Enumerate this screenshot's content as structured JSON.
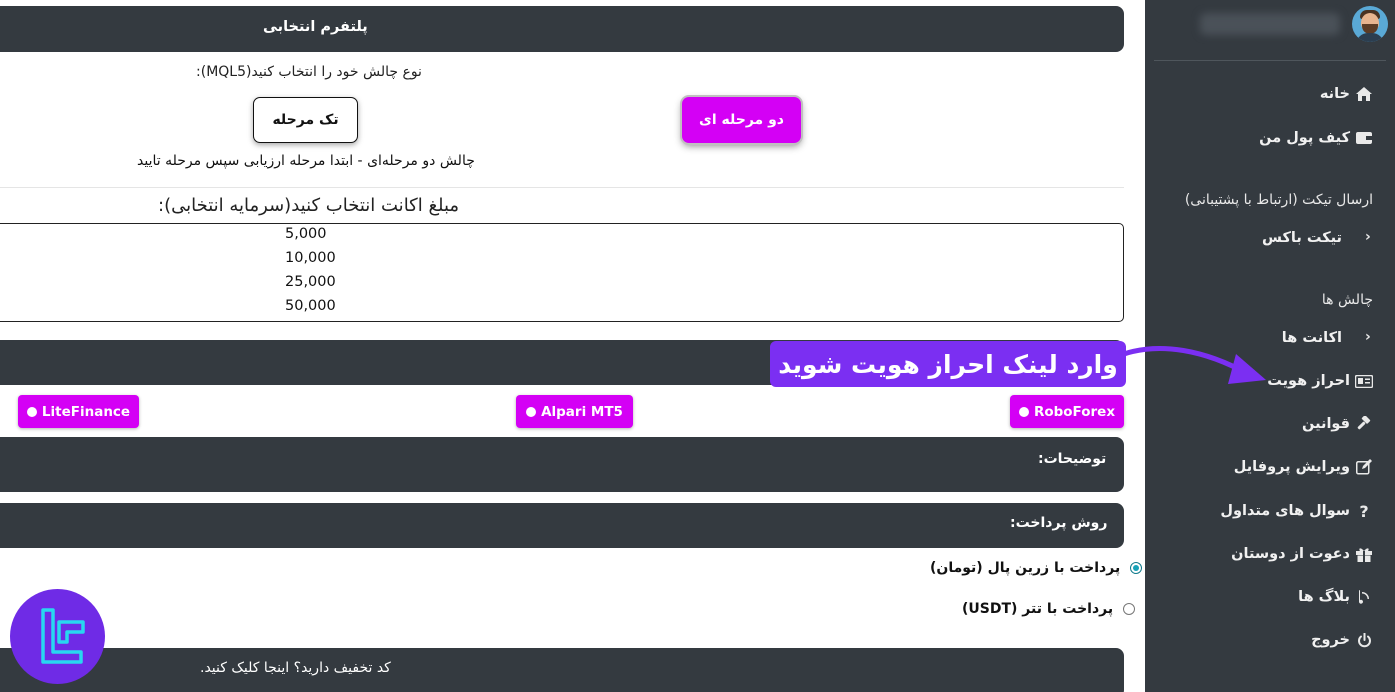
{
  "sidebar": {
    "items": [
      {
        "label": "خانه",
        "icon": "home-icon"
      },
      {
        "label": "کیف پول من",
        "icon": "wallet-icon"
      },
      {
        "label": "ارسال تیکت (ارتباط با پشتیبانی)"
      },
      {
        "label": "تیکت باکس"
      },
      {
        "label": "چالش ها"
      },
      {
        "label": "اکانت ها"
      },
      {
        "label": "احراز هویت",
        "icon": "id-card-icon"
      },
      {
        "label": "قوانین",
        "icon": "gavel-icon"
      },
      {
        "label": "ویرایش پروفایل",
        "icon": "edit-icon"
      },
      {
        "label": "سوال های متداول",
        "icon": "question-icon"
      },
      {
        "label": "دعوت از دوستان",
        "icon": "gift-icon"
      },
      {
        "label": "بلاگ ها",
        "icon": "blog-icon"
      },
      {
        "label": "خروج",
        "icon": "power-icon"
      }
    ]
  },
  "main": {
    "platform_title": "پلتفرم انتخابی",
    "challenge_type_label": "نوع چالش خود را انتخاب کنید(MQL5):",
    "two_stage_label": "دو مرحله ای",
    "one_stage_label": "تک مرحله",
    "challenge_description": "چالش دو مرحله‌ای - ابتدا مرحله ارزیابی سپس مرحله تایید",
    "amount_label": "مبلغ اکانت انتخاب کنید(سرمایه انتخابی):",
    "amount_options": [
      "5,000",
      "10,000",
      "25,000",
      "50,000"
    ],
    "brokers": [
      "RoboForex",
      "Alpari MT5",
      "LiteFinance"
    ],
    "description_title": "توضیحات:",
    "payment_title": "روش پرداخت:",
    "payment_options": [
      "پرداخت با زرین پال (تومان)",
      "پرداخت با تتر (USDT)"
    ],
    "coupon_text": "کد تخفیف دارید؟ اینجا کلیک کنید."
  },
  "annotation": {
    "callout_text": "وارد لینک احراز هویت شوید",
    "color": "#7b2ff2"
  },
  "colors": {
    "sidebar_bg": "#343a40",
    "accent_magenta": "#d400f5",
    "dark_bar": "#343a40"
  }
}
